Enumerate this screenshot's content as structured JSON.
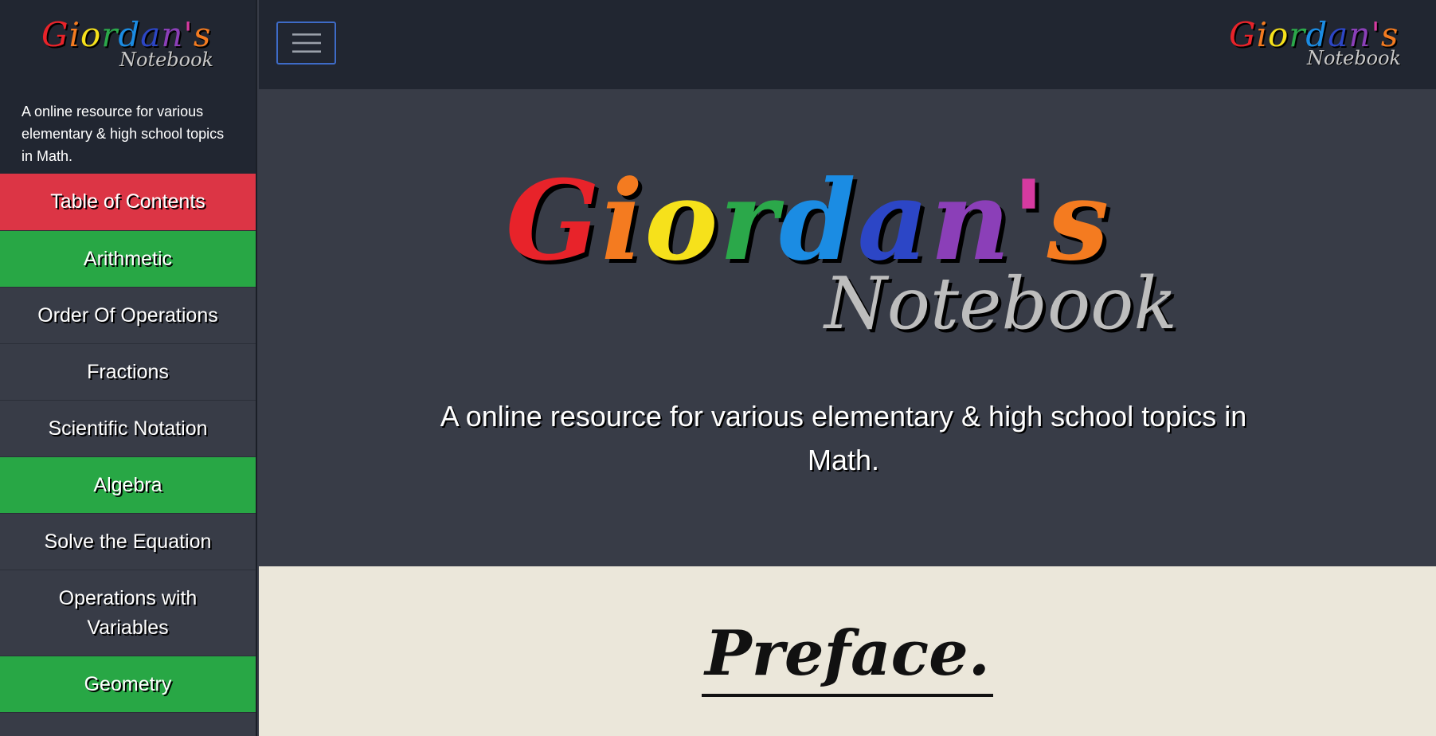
{
  "brand": {
    "letters": [
      {
        "ch": "G",
        "color": "#e8232a"
      },
      {
        "ch": "i",
        "color": "#f47b20"
      },
      {
        "ch": "o",
        "color": "#f6e11b"
      },
      {
        "ch": "r",
        "color": "#2ba84a"
      },
      {
        "ch": "d",
        "color": "#1b8ce3"
      },
      {
        "ch": "a",
        "color": "#2c46c6"
      },
      {
        "ch": "n",
        "color": "#8b3fb8"
      },
      {
        "ch": "'",
        "color": "#d63aa0"
      },
      {
        "ch": "s",
        "color": "#f47b20"
      }
    ],
    "subtitle": "Notebook"
  },
  "sidebar": {
    "tagline": "A online resource for various elementary & high school topics in Math.",
    "items": [
      {
        "label": "Table of Contents",
        "style": "red",
        "name": "table-of-contents"
      },
      {
        "label": "Arithmetic",
        "style": "green",
        "name": "arithmetic"
      },
      {
        "label": "Order Of Operations",
        "style": "dark",
        "name": "order-of-operations"
      },
      {
        "label": "Fractions",
        "style": "dark",
        "name": "fractions"
      },
      {
        "label": "Scientific Notation",
        "style": "dark",
        "name": "scientific-notation"
      },
      {
        "label": "Algebra",
        "style": "green",
        "name": "algebra"
      },
      {
        "label": "Solve the Equation",
        "style": "dark",
        "name": "solve-the-equation"
      },
      {
        "label": "Operations with Variables",
        "style": "dark",
        "name": "operations-with-variables"
      },
      {
        "label": "Geometry",
        "style": "green",
        "name": "geometry"
      }
    ]
  },
  "topbar": {
    "menu_icon": "hamburger-menu-icon"
  },
  "hero": {
    "tagline": "A online resource for various elementary & high school topics in Math."
  },
  "content": {
    "preface_title": "Preface."
  },
  "colors": {
    "sidebar_bg": "#383c47",
    "header_bg": "#212631",
    "red": "#dc3545",
    "green": "#28a745",
    "content_bg": "#ebe7da"
  }
}
